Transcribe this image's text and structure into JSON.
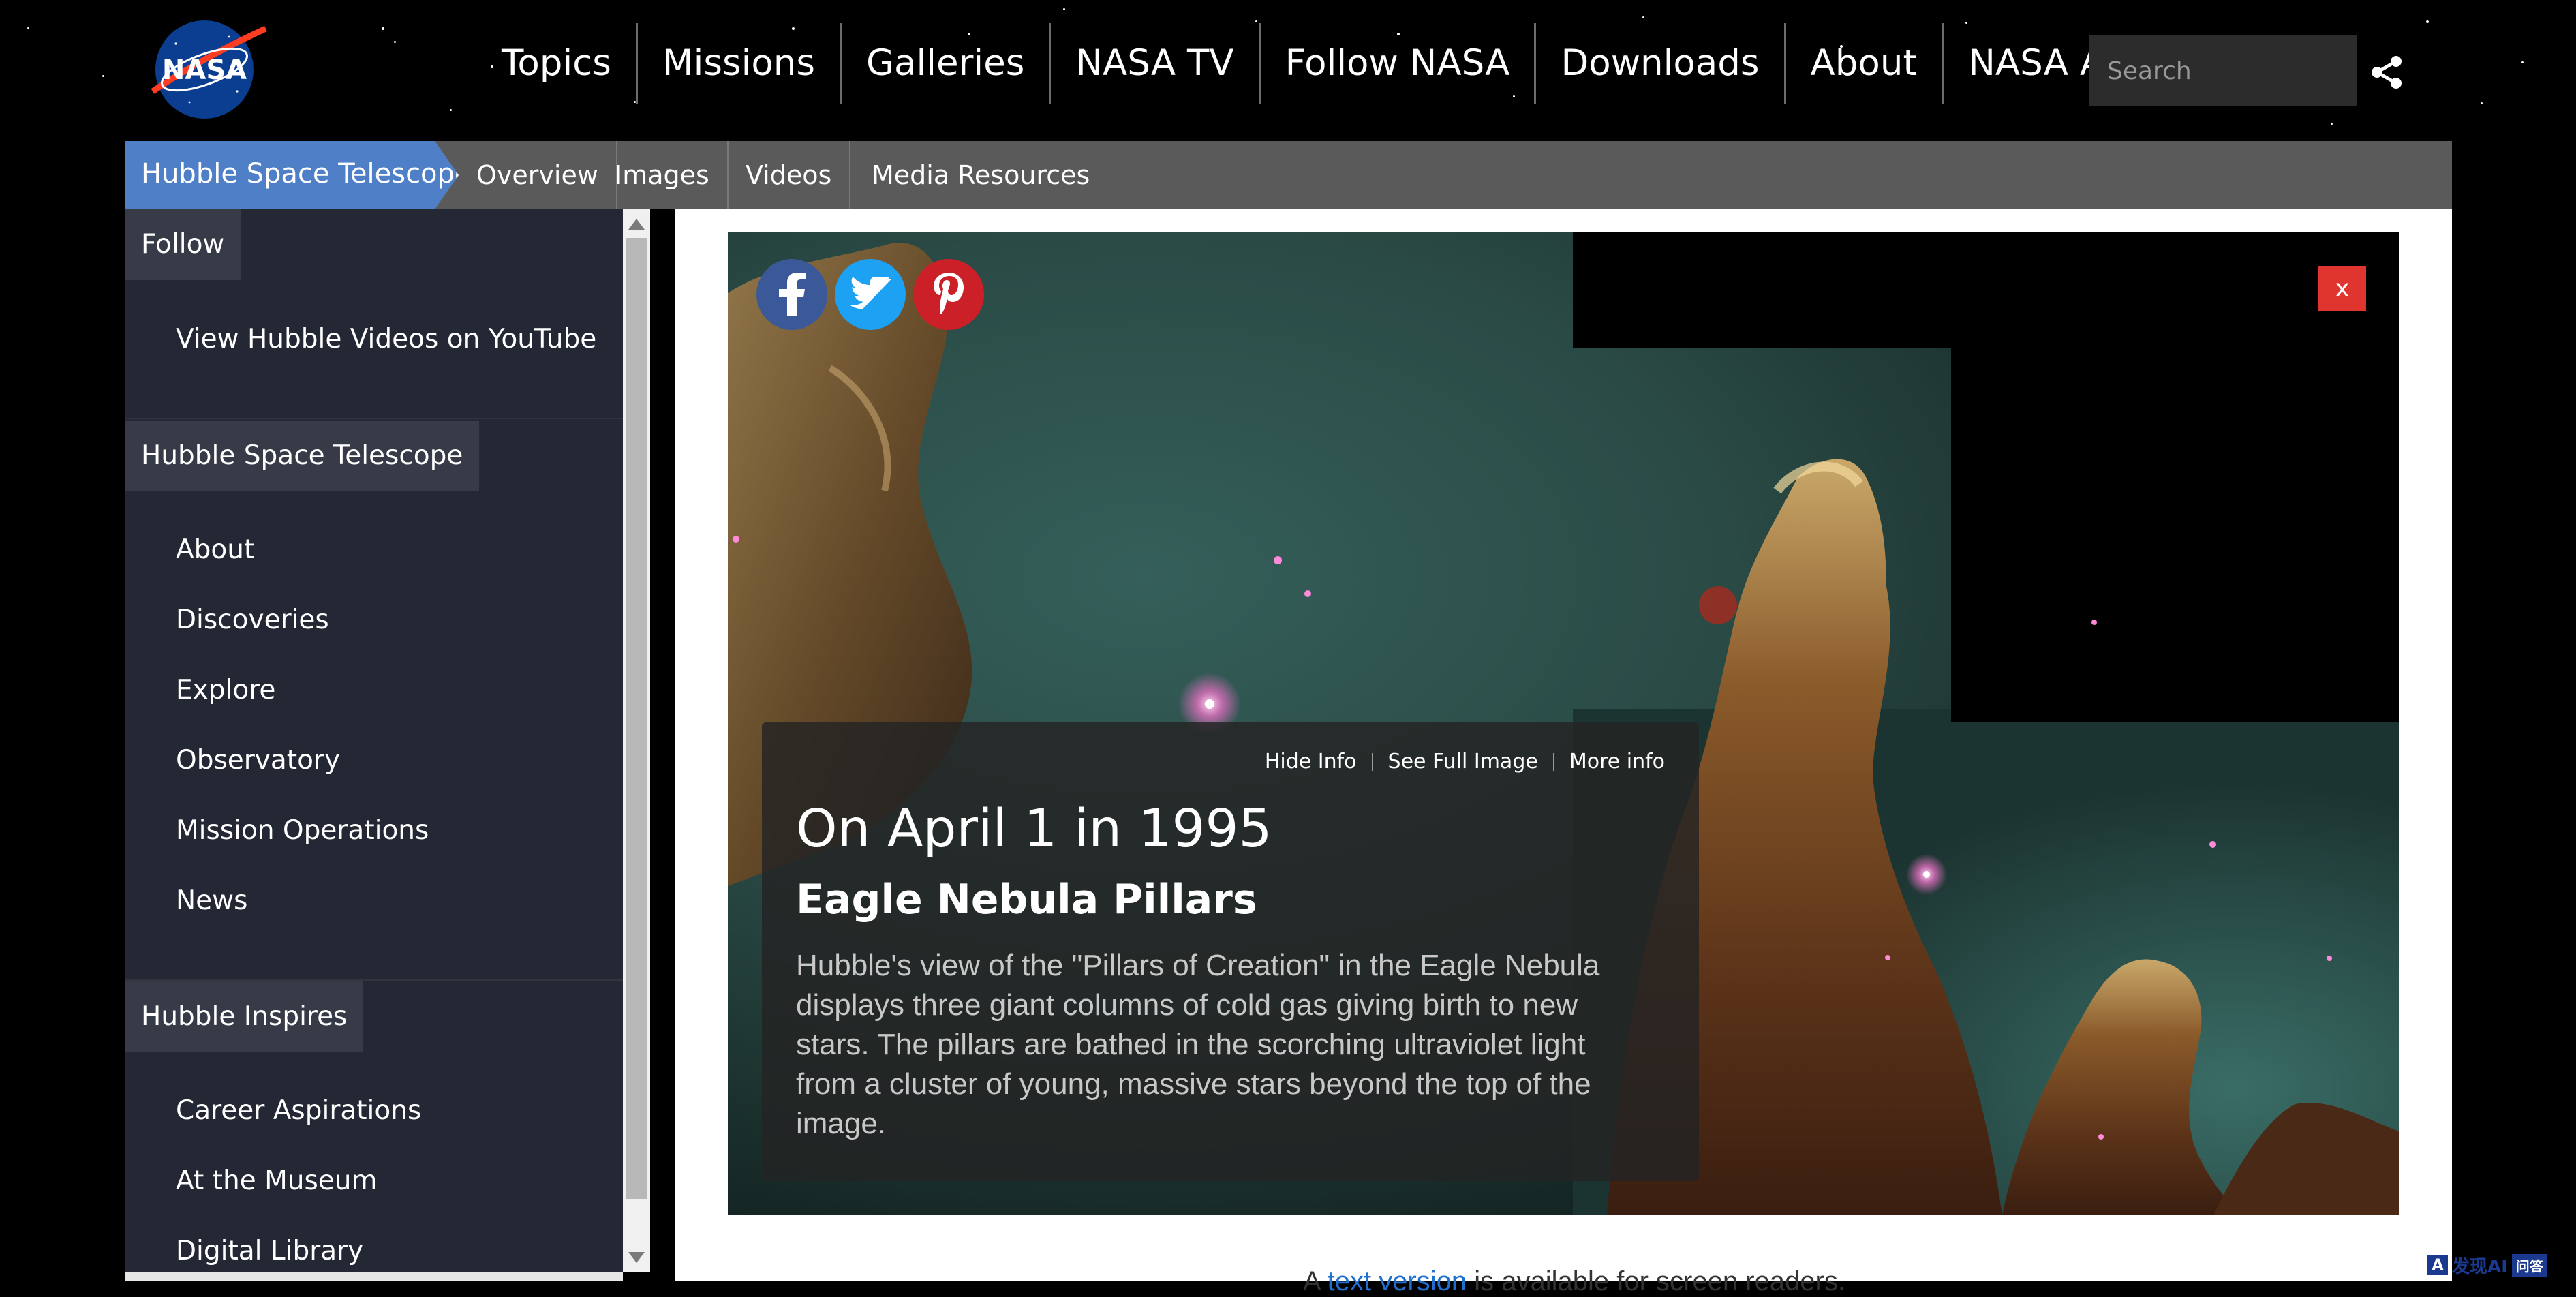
{
  "header": {
    "logo_text": "NASA",
    "nav": [
      "Topics",
      "Missions",
      "Galleries",
      "NASA TV",
      "Follow NASA",
      "Downloads",
      "About",
      "NASA Audiences"
    ],
    "search_placeholder": "Search"
  },
  "subnav": {
    "home": "Hubble Space Telescope",
    "links": [
      "Overview",
      "Images",
      "Videos",
      "Media Resources"
    ]
  },
  "sidebar": {
    "sections": [
      {
        "title": "Follow",
        "items": [
          "View Hubble Videos on YouTube"
        ]
      },
      {
        "title": "Hubble Space Telescope",
        "items": [
          "About",
          "Discoveries",
          "Explore",
          "Observatory",
          "Mission Operations",
          "News"
        ]
      },
      {
        "title": "Hubble Inspires",
        "items": [
          "Career Aspirations",
          "At the Museum",
          "Digital Library"
        ]
      }
    ]
  },
  "lightbox": {
    "close_label": "x",
    "social": [
      "facebook-icon",
      "twitter-icon",
      "pinterest-icon"
    ],
    "links": [
      "Hide Info",
      "See Full Image",
      "More info"
    ],
    "date": "On April 1 in 1995",
    "title": "Eagle Nebula Pillars",
    "description": "Hubble's view of the \"Pillars of Creation\" in the Eagle Nebula displays three giant columns of cold gas giving birth to new stars. The pillars are bathed in the scorching ultraviolet light from a cluster of young, massive stars beyond the top of the image."
  },
  "footer_note": {
    "before": "A ",
    "link": "text version",
    "after": " is available for screen readers."
  },
  "watermark": {
    "logo": "A",
    "brand": "发现AI",
    "tag": "问答"
  },
  "colors": {
    "subnav_active": "#4f7fc7",
    "facebook": "#3b5998",
    "twitter": "#1da1f2",
    "pinterest": "#cb2027",
    "close": "#e0342f"
  }
}
